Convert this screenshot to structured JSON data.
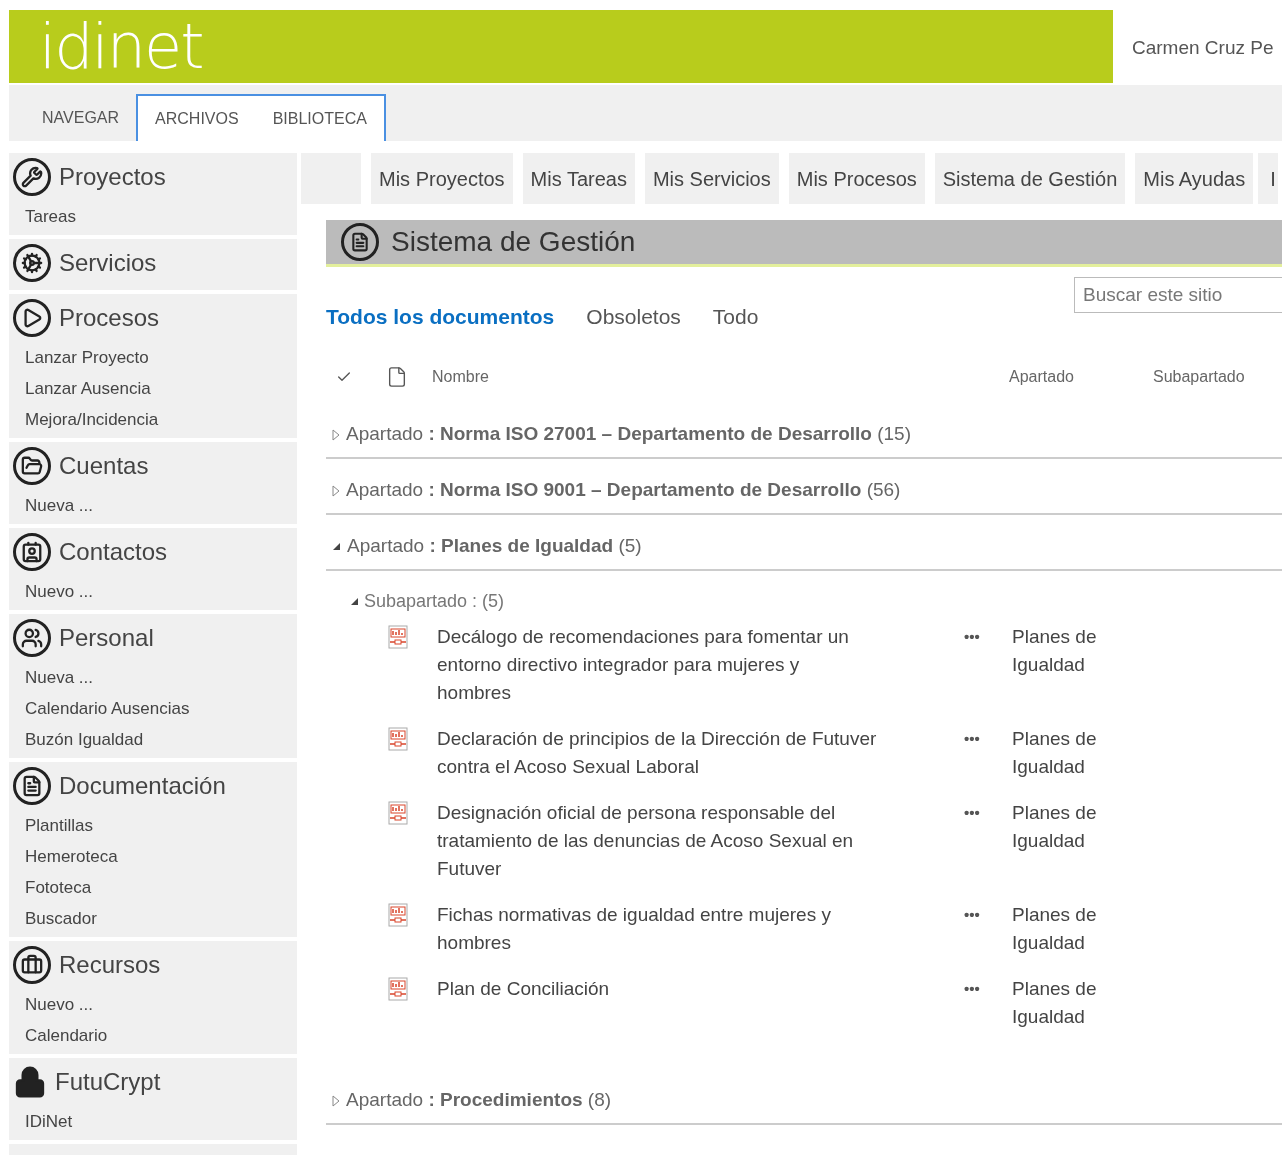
{
  "header": {
    "logo": "idinet",
    "user": "Carmen Cruz Pe"
  },
  "ribbon_tabs": [
    {
      "label": "NAVEGAR",
      "selected": false
    },
    {
      "label": "ARCHIVOS",
      "selected": true
    },
    {
      "label": "BIBLIOTECA",
      "selected": true
    }
  ],
  "sidebar": [
    {
      "title": "Proyectos",
      "items": [
        "Tareas"
      ]
    },
    {
      "title": "Servicios"
    },
    {
      "title": "Procesos",
      "items": [
        "Lanzar Proyecto",
        "Lanzar Ausencia",
        "Mejora/Incidencia"
      ]
    },
    {
      "title": "Cuentas",
      "items": [
        "Nueva ..."
      ]
    },
    {
      "title": "Contactos",
      "items": [
        "Nuevo ..."
      ]
    },
    {
      "title": "Personal",
      "items": [
        "Nueva ...",
        "Calendario Ausencias",
        "Buzón Igualdad"
      ]
    },
    {
      "title": "Documentación",
      "items": [
        "Plantillas",
        "Hemeroteca",
        "Fototeca",
        "Buscador"
      ]
    },
    {
      "title": "Recursos",
      "items": [
        "Nuevo ...",
        "Calendario"
      ]
    },
    {
      "title": "FutuCrypt",
      "items": [
        "IDiNet"
      ]
    }
  ],
  "top_nav": [
    "Mis Proyectos",
    "Mis Tareas",
    "Mis Servicios",
    "Mis Procesos",
    "Sistema de Gestión",
    "Mis Ayudas",
    "I"
  ],
  "page_title": "Sistema de Gestión",
  "views": [
    {
      "label": "Todos los documentos",
      "selected": true
    },
    {
      "label": "Obsoletos",
      "selected": false
    },
    {
      "label": "Todo",
      "selected": false
    }
  ],
  "search": {
    "placeholder": "Buscar este sitio"
  },
  "columns": [
    "Nombre",
    "Apartado",
    "Subapartado"
  ],
  "groups": [
    {
      "title": "Apartado **: Norma ISO 27001 – Departamento de Desarrollo**",
      "count": "(15)",
      "expanded": false
    },
    {
      "title": "Apartado **: Norma ISO 9001 – Departamento de Desarrollo**",
      "count": "(56)",
      "expanded": false
    },
    {
      "title": "Apartado **: Planes de Igualdad**",
      "count": "(5)",
      "expanded": true,
      "subgroup": {
        "title": "Subapartado : (5)",
        "expanded": true
      },
      "documents": [
        {
          "name": "Decálogo de recomendaciones para fomentar un entorno directivo integrador para mujeres y hombres",
          "menu": "•••",
          "apartado": "Planes de Igualdad"
        },
        {
          "name": "Declaración de principios de la Dirección de Futuver contra el Acoso Sexual Laboral",
          "menu": "•••",
          "apartado": "Planes de Igualdad"
        },
        {
          "name": "Designación oficial de persona responsable del tratamiento de las denuncias de Acoso Sexual en Futuver",
          "menu": "•••",
          "apartado": "Planes de Igualdad"
        },
        {
          "name": "Fichas normativas de igualdad entre mujeres y hombres",
          "menu": "•••",
          "apartado": "Planes de Igualdad"
        },
        {
          "name": "Plan de Conciliación",
          "menu": "•••",
          "apartado": "Planes de Igualdad"
        }
      ]
    },
    {
      "title": "Apartado **: Procedimientos**",
      "count": "(8)",
      "expanded": false
    }
  ]
}
